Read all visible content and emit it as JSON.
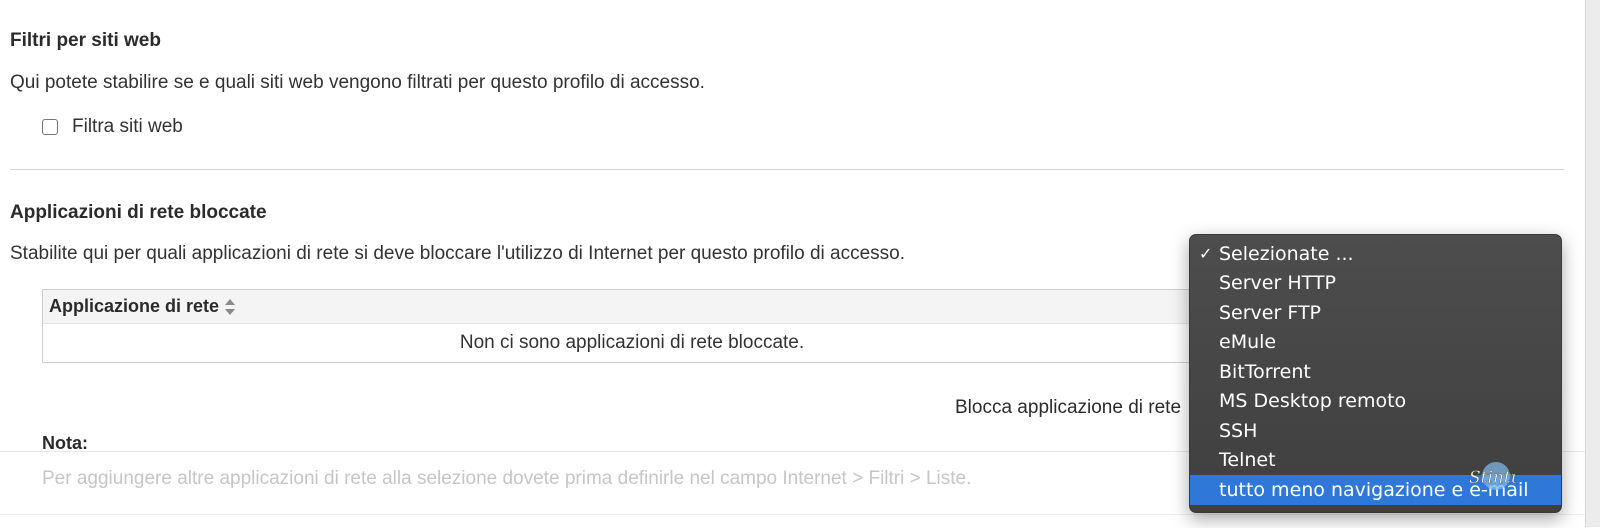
{
  "websites": {
    "title": "Filtri per siti web",
    "description": "Qui potete stabilire se e quali siti web vengono filtrati per questo profilo di accesso.",
    "checkbox_label": "Filtra siti web",
    "checkbox_checked": false
  },
  "apps": {
    "title": "Applicazioni di rete bloccate",
    "description": "Stabilite qui per quali applicazioni di rete si deve bloccare l'utilizzo di Internet per questo profilo di accesso.",
    "table": {
      "column_header": "Applicazione di rete",
      "empty_message": "Non ci sono applicazioni di rete bloccate."
    },
    "block_label": "Blocca applicazione di rete",
    "note_label": "Nota:",
    "note_text": "Per aggiungere altre applicazioni di rete alla selezione dovete prima definirle nel campo Internet > Filtri > Liste."
  },
  "dropdown": {
    "items": [
      {
        "label": "Selezionate ...",
        "checked": true,
        "highlighted": false
      },
      {
        "label": "Server HTTP",
        "checked": false,
        "highlighted": false
      },
      {
        "label": "Server FTP",
        "checked": false,
        "highlighted": false
      },
      {
        "label": "eMule",
        "checked": false,
        "highlighted": false
      },
      {
        "label": "BitTorrent",
        "checked": false,
        "highlighted": false
      },
      {
        "label": "MS Desktop remoto",
        "checked": false,
        "highlighted": false
      },
      {
        "label": "SSH",
        "checked": false,
        "highlighted": false
      },
      {
        "label": "Telnet",
        "checked": false,
        "highlighted": false
      },
      {
        "label": "tutto meno navigazione e e-mail",
        "checked": false,
        "highlighted": true
      }
    ],
    "check_glyph": "✓",
    "highlight_color": "#2f77d9"
  },
  "watermark": {
    "text": "Stintup"
  }
}
